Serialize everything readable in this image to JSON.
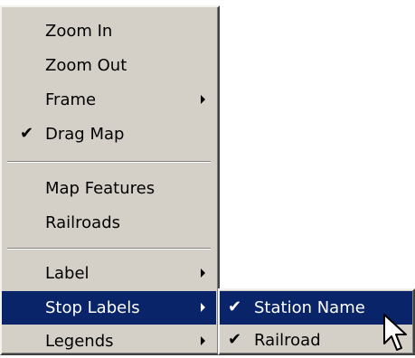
{
  "main_menu": {
    "items": [
      {
        "label": "Zoom In"
      },
      {
        "label": "Zoom Out"
      },
      {
        "label": "Frame",
        "submenu_arrow": true
      },
      {
        "label": "Drag Map",
        "checked": true,
        "check_glyph": "✔"
      },
      {
        "label": "Map Features"
      },
      {
        "label": "Railroads"
      },
      {
        "label": "Label",
        "submenu_arrow": true
      },
      {
        "label": "Stop Labels",
        "submenu_arrow": true,
        "highlighted": true
      },
      {
        "label": "Legends",
        "submenu_arrow": true
      }
    ]
  },
  "sub_menu": {
    "items": [
      {
        "label": "Station Name",
        "checked": true,
        "highlighted": true,
        "check_glyph": "✔"
      },
      {
        "label": "Railroad",
        "checked": true,
        "check_glyph": "✔"
      }
    ]
  },
  "colors": {
    "menu_background": "#d4d0c8",
    "highlight_background": "#0a246a",
    "highlight_text": "#ffffff",
    "text": "#000000"
  },
  "icons": {
    "submenu_arrow": "triangle-right-icon",
    "check": "checkmark-icon",
    "cursor": "arrow-cursor-icon"
  }
}
